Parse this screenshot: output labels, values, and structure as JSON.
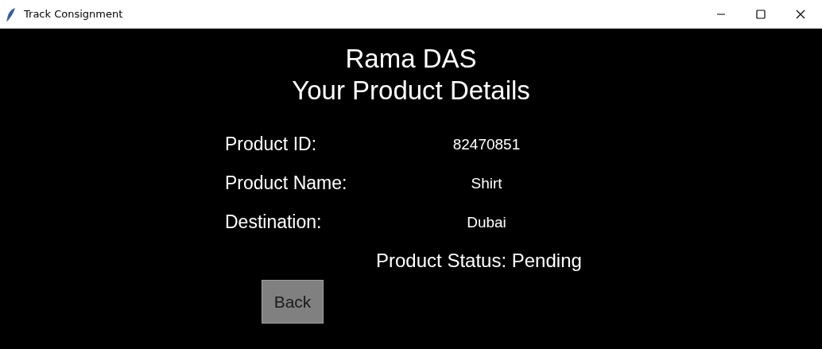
{
  "window": {
    "title": "Track Consignment"
  },
  "heading": {
    "name": "Rama DAS",
    "subtitle": "Your Product Details"
  },
  "fields": [
    {
      "label": "Product ID:",
      "value": "82470851"
    },
    {
      "label": "Product Name:",
      "value": "Shirt"
    },
    {
      "label": "Destination:",
      "value": "Dubai"
    }
  ],
  "status": "Product Status: Pending",
  "buttons": [
    {
      "label": "Back"
    }
  ]
}
